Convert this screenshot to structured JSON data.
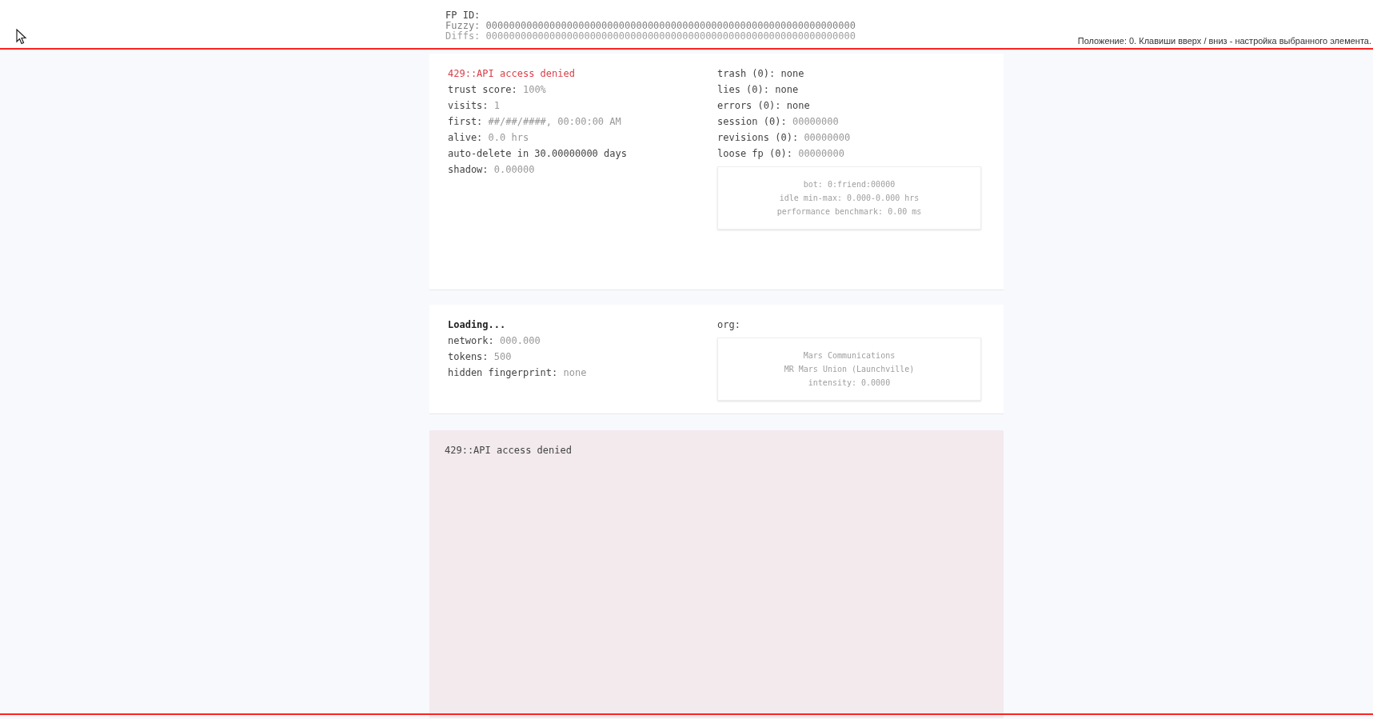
{
  "status_hint": "Положение: 0. Клавиши вверх / вниз - настройка выбранного элемента.",
  "fingerprint": {
    "title": "FP ID:",
    "rows": [
      {
        "label": "Fuzzy:",
        "value": "0000000000000000000000000000000000000000000000000000000000000000",
        "faded": false
      },
      {
        "label": "Diffs:",
        "value": "0000000000000000000000000000000000000000000000000000000000000000",
        "faded": true
      }
    ]
  },
  "trust_card": {
    "error": "429::API access denied",
    "left": [
      {
        "label": "trust score:",
        "value": "100%",
        "faded": true
      },
      {
        "label": "visits:",
        "value": "1",
        "faded": true
      },
      {
        "label": "first:",
        "value": "##/##/####, 00:00:00 AM",
        "faded": true
      },
      {
        "label": "alive:",
        "value": "0.0 hrs",
        "faded": true
      },
      {
        "label": "auto-delete in 30.00000000 days"
      },
      {
        "label": "shadow:",
        "value": "0.00000",
        "faded": true
      }
    ],
    "right": [
      {
        "label": "trash (0):",
        "value": "none",
        "faded": false
      },
      {
        "label": "lies (0):",
        "value": "none",
        "faded": false
      },
      {
        "label": "errors (0):",
        "value": "none",
        "faded": false
      },
      {
        "label": "session (0):",
        "value": "00000000",
        "faded": true
      },
      {
        "label": "revisions (0):",
        "value": "00000000",
        "faded": true
      },
      {
        "label": "loose fp (0):",
        "value": "00000000",
        "faded": true
      }
    ],
    "box": [
      "bot: 0:friend:00000",
      "idle min-max: 0.000-0.000 hrs",
      "performance benchmark: 0.00 ms"
    ]
  },
  "network_card": {
    "title": "Loading...",
    "left": [
      {
        "label": "network:",
        "value": "000.000",
        "faded": true
      },
      {
        "label": "tokens:",
        "value": "500",
        "faded": true
      },
      {
        "label": "hidden fingerprint:",
        "value": "none",
        "faded": true
      }
    ],
    "right_label": "org:",
    "box": [
      "Mars Communications",
      "MR Mars Union (Launchville)",
      "intensity: 0.0000"
    ]
  },
  "error_panel": {
    "message": "429::API access denied"
  }
}
